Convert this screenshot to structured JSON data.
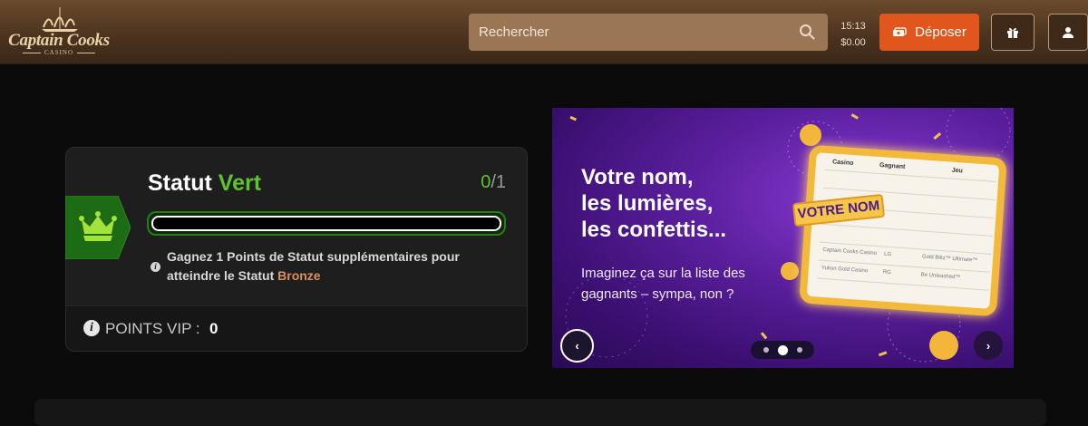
{
  "header": {
    "logo_text": "Captain Cooks",
    "logo_sub": "CASINO",
    "search_placeholder": "Rechercher",
    "clock": "15:13",
    "balance": "$0.00",
    "deposit_label": "Déposer",
    "colors": {
      "accent": "#e0561d",
      "header_bg": "#5a3d25",
      "search_bg": "#9b7654"
    }
  },
  "status": {
    "title": "Statut",
    "level": "Vert",
    "count_current": "0",
    "count_sep": "/",
    "count_total": "1",
    "progress": 0,
    "msg_part1": "Gagnez ",
    "msg_points": "1",
    "msg_part2": " Points de Statut supplémentaires pour atteindre le Statut ",
    "msg_next_level": "Bronze",
    "vip_label": "POINTS VIP :",
    "vip_value": "0",
    "colors": {
      "green": "#5fc22f",
      "bronze": "#d9915a"
    }
  },
  "banner": {
    "headline_1": "Votre nom,",
    "headline_2": "les lumières,",
    "headline_3": "les confettis...",
    "sub_1": "Imaginez ça sur la liste des",
    "sub_2": "gagnants – sympa, non ?",
    "board_tag": "VOTRE NOM",
    "board_headers": [
      "Casino",
      "Gagnant",
      "Jeu"
    ],
    "board_rows": [
      {
        "casino": "Captain Cooks Casino",
        "winner": "LG",
        "game": "Gold Blitz™ Ultimate™"
      },
      {
        "casino": "Yukon Gold Casino",
        "winner": "RG",
        "game": "Be Unleashed™"
      }
    ],
    "prev_icon": "‹",
    "next_icon": "›",
    "active_slide": 2,
    "slide_count": 3
  }
}
